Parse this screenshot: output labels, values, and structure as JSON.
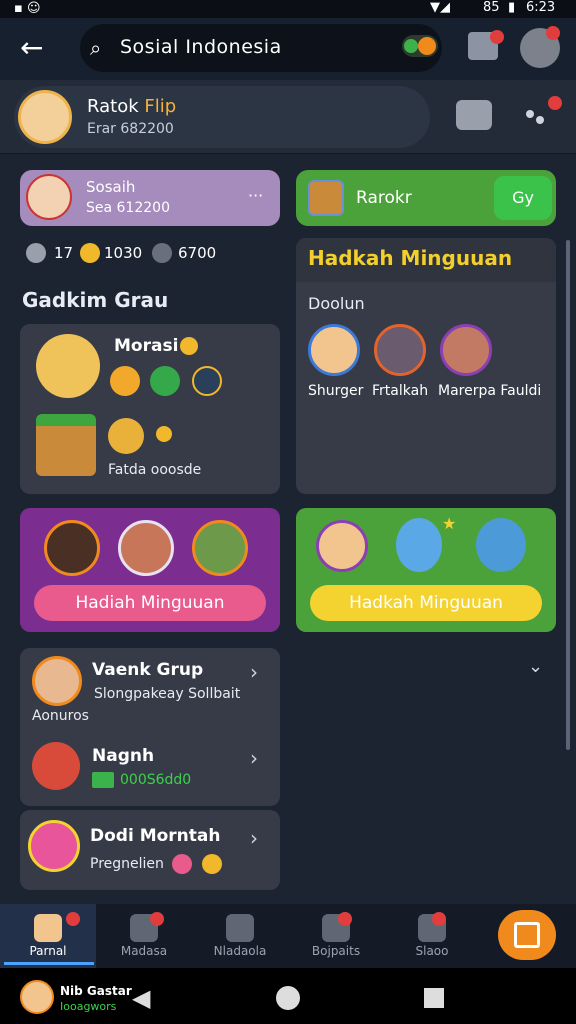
{
  "status": {
    "time": "6:23",
    "battery": "85"
  },
  "search": {
    "text": "Sosial Indonesia"
  },
  "profile": {
    "name_a": "Ratok",
    "name_b": "Flip",
    "sub": "Erar 682200"
  },
  "card_small": {
    "title": "Sosaih",
    "sub": "Sea 612200",
    "menu": "···"
  },
  "card_green": {
    "title": "Rarokr",
    "btn": "Gy"
  },
  "stats": {
    "a": "17",
    "b": "1030",
    "c": "6700"
  },
  "section": {
    "title": "Gadkim Grau"
  },
  "weekly": {
    "title": "Hadkah Minguuan",
    "sub": "Doolun",
    "people": [
      "Shurger",
      "Frtalkah",
      "Marerpa Fauldi"
    ]
  },
  "char_card": {
    "name": "Morasi",
    "footer": "Fatda ooosde"
  },
  "promo_purple": {
    "btn": "Hadiah Minguuan"
  },
  "promo_green": {
    "btn": "Hadkah Minguuan"
  },
  "list": [
    {
      "title": "Vaenk Grup",
      "sub": "Slongpakeay Sollbait",
      "extra": "Aonuros"
    },
    {
      "title": "Nagnh",
      "sub": "000S6dd0"
    },
    {
      "title": "Dodi Morntah",
      "sub": "Pregnelien"
    }
  ],
  "nav": [
    "Parnal",
    "Madasa",
    "Nladaola",
    "Bojpaits",
    "Slaoo"
  ],
  "footer_user": {
    "name": "Nib Gastar",
    "sub": "Iooagwors"
  },
  "colors": {
    "bg": "#1d2431",
    "purple": "#7b2e8f",
    "green": "#4ca23a",
    "yellow": "#f4d331",
    "pink": "#e95b8d",
    "orange": "#f08a1d"
  }
}
